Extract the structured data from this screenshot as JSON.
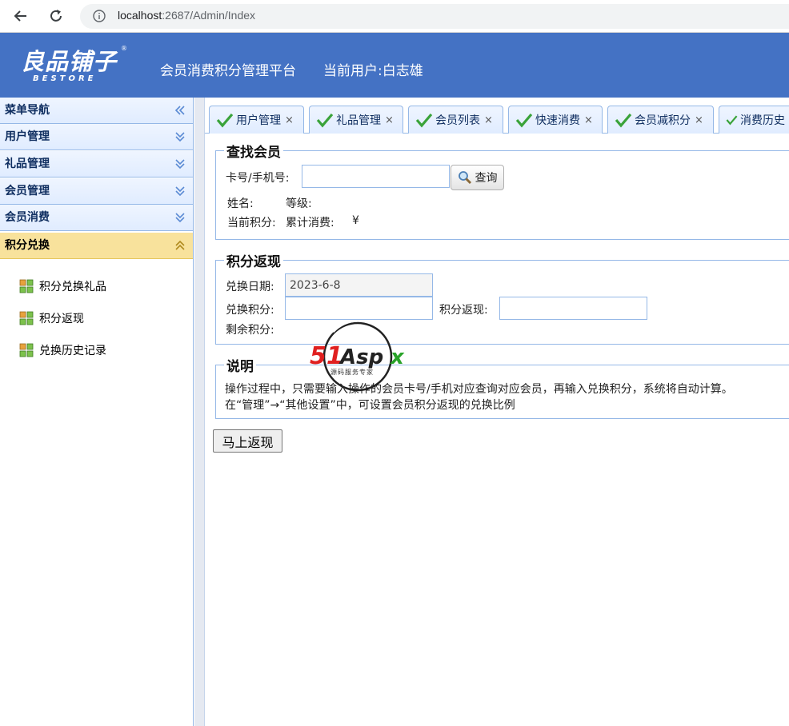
{
  "browser": {
    "url_host": "localhost",
    "url_path": ":2687/Admin/Index"
  },
  "header": {
    "logo_cn": "良品铺子",
    "logo_en": "BESTORE",
    "logo_reg": "®",
    "platform_title": "会员消费积分管理平台",
    "current_user": "当前用户:白志雄",
    "color": "#4472c4"
  },
  "sidebar": {
    "title": "菜单导航",
    "groups": [
      {
        "label": "用户管理",
        "expanded": false
      },
      {
        "label": "礼品管理",
        "expanded": false
      },
      {
        "label": "会员管理",
        "expanded": false
      },
      {
        "label": "会员消费",
        "expanded": false
      },
      {
        "label": "积分兑换",
        "expanded": true
      }
    ],
    "links": [
      {
        "label": "积分兑换礼品",
        "icon": "grid-icon"
      },
      {
        "label": "积分返现",
        "icon": "grid-icon"
      },
      {
        "label": "兑换历史记录",
        "icon": "grid-icon"
      }
    ]
  },
  "tabs": [
    {
      "label": "用户管理",
      "close": "×"
    },
    {
      "label": "礼品管理",
      "close": "×"
    },
    {
      "label": "会员列表",
      "close": "×"
    },
    {
      "label": "快速消费",
      "close": "×"
    },
    {
      "label": "会员减积分",
      "close": "×"
    },
    {
      "label": "消费历史",
      "close": ""
    }
  ],
  "find_member": {
    "legend": "查找会员",
    "card_label": "卡号/手机号:",
    "card_value": "",
    "search_label": "查询",
    "name_label": "姓名:",
    "level_label": "等级:",
    "points_label": "当前积分:",
    "total_label": "累计消费:",
    "total_currency": "¥"
  },
  "cashback": {
    "legend": "积分返现",
    "date_label": "兑换日期:",
    "date_value": "2023-6-8",
    "points_label": "兑换积分:",
    "points_value": "",
    "cash_label": "积分返现:",
    "cash_value": "",
    "remaining_label": "剩余积分:"
  },
  "notes": {
    "legend": "说明",
    "line1": "操作过程中，只需要输入操作的会员卡号/手机对应查询对应会员，再输入兑换积分，系统将自动计算。",
    "line2": "在“管理”→“其他设置”中，可设置会员积分返现的兑换比例"
  },
  "submit_label": "马上返现",
  "watermark": {
    "text": "51Aspx",
    "sub": "源码服务专家"
  }
}
